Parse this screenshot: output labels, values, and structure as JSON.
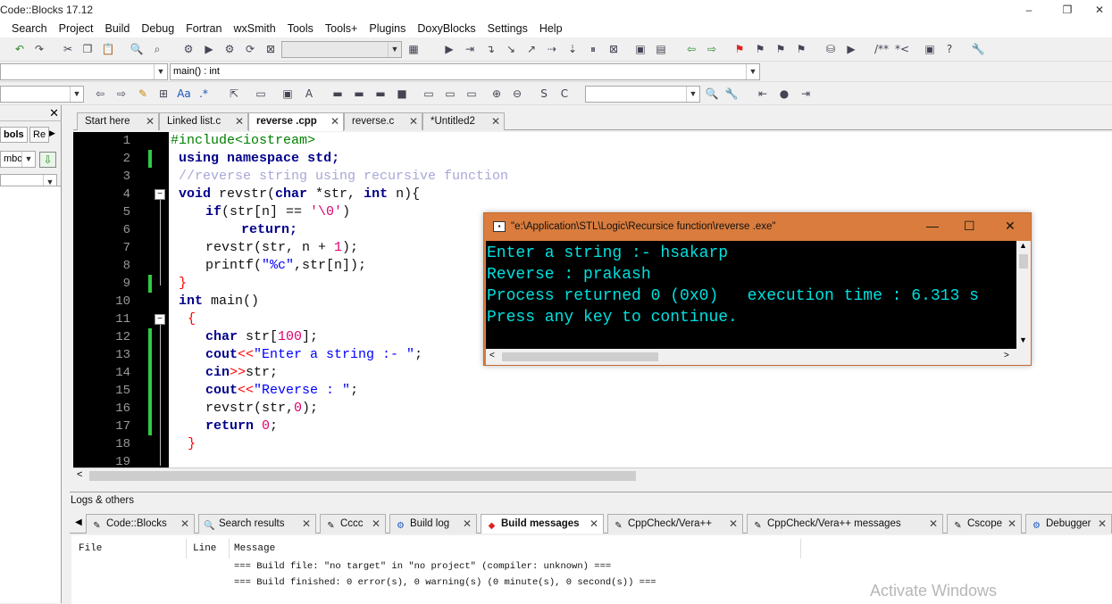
{
  "app": {
    "title": "Code::Blocks 17.12",
    "win_controls": {
      "minimize": "–",
      "restore": "❐",
      "close": "✕"
    }
  },
  "menu": [
    "Search",
    "Project",
    "Build",
    "Debug",
    "Fortran",
    "wxSmith",
    "Tools",
    "Tools+",
    "Plugins",
    "DoxyBlocks",
    "Settings",
    "Help"
  ],
  "toolbar": {
    "scope_combo": "main() : int",
    "search_combo": ""
  },
  "left_panel": {
    "tab_symbols": "bols",
    "tab_resources": "Re",
    "combo_symbols": "mbc",
    "close": "✕"
  },
  "editor_tabs": [
    {
      "label": "Start here",
      "active": false
    },
    {
      "label": "Linked list.c",
      "active": false
    },
    {
      "label": "reverse .cpp",
      "active": true
    },
    {
      "label": "reverse.c",
      "active": false
    },
    {
      "label": "*Untitled2",
      "active": false
    }
  ],
  "line_numbers": [
    "1",
    "2",
    "3",
    "4",
    "5",
    "6",
    "7",
    "8",
    "9",
    "10",
    "11",
    "12",
    "13",
    "14",
    "15",
    "16",
    "17",
    "18",
    "19"
  ],
  "code": {
    "l1": "#include<iostream>",
    "l2a": "using",
    "l2b": "namespace",
    "l2c": "std;",
    "l3": "//reverse string using recursive function",
    "l4a": "void",
    "l4b": " revstr(",
    "l4c": "char",
    "l4d": " *str, ",
    "l4e": "int",
    "l4f": " n){",
    "l5a": "if",
    "l5b": "(str[n] == ",
    "l5c": "'\\0'",
    "l5d": ")",
    "l6": "return;",
    "l7a": "revstr(str, n + ",
    "l7b": "1",
    "l7c": ");",
    "l8a": "printf(",
    "l8b": "\"%c\"",
    "l8c": ",str[n]);",
    "l9": "}",
    "l10a": "int",
    "l10b": " main()",
    "l11": "{",
    "l12a": "char",
    "l12b": " str[",
    "l12c": "100",
    "l12d": "];",
    "l13a": "cout",
    "l13b": "<<",
    "l13c": "\"Enter a string :- \"",
    "l13d": ";",
    "l14a": "cin",
    "l14b": ">>",
    "l14c": "str;",
    "l15a": "cout",
    "l15b": "<<",
    "l15c": "\"Reverse : \"",
    "l15d": ";",
    "l16a": "revstr(str,",
    "l16b": "0",
    "l16c": ");",
    "l17a": "return",
    "l17b": " 0",
    "l17c": ";",
    "l18": "}"
  },
  "console": {
    "title": "\"e:\\Application\\STL\\Logic\\Recursice function\\reverse .exe\"",
    "lines": [
      "Enter a string :- hsakarp",
      "Reverse : prakash",
      "Process returned 0 (0x0)   execution time : 6.313 s",
      "Press any key to continue."
    ],
    "btn_min": "—",
    "btn_max": "☐",
    "btn_close": "✕"
  },
  "logs": {
    "title": "Logs & others",
    "tabs": [
      {
        "label": "Code::Blocks",
        "icon": "✎",
        "active": false
      },
      {
        "label": "Search results",
        "icon": "🔍",
        "active": false
      },
      {
        "label": "Cccc",
        "icon": "✎",
        "active": false
      },
      {
        "label": "Build log",
        "icon": "⚙",
        "active": false
      },
      {
        "label": "Build messages",
        "icon": "◆",
        "active": true
      },
      {
        "label": "CppCheck/Vera++",
        "icon": "✎",
        "active": false
      },
      {
        "label": "CppCheck/Vera++ messages",
        "icon": "✎",
        "active": false
      },
      {
        "label": "Cscope",
        "icon": "✎",
        "active": false
      },
      {
        "label": "Debugger",
        "icon": "⚙",
        "active": false
      }
    ],
    "columns": {
      "file": "File",
      "line": "Line",
      "message": "Message"
    },
    "messages": [
      "=== Build file: \"no target\" in \"no project\" (compiler: unknown) ===",
      "=== Build finished: 0 error(s), 0 warning(s) (0 minute(s), 0 second(s)) ==="
    ]
  },
  "watermark": "Activate Windows"
}
